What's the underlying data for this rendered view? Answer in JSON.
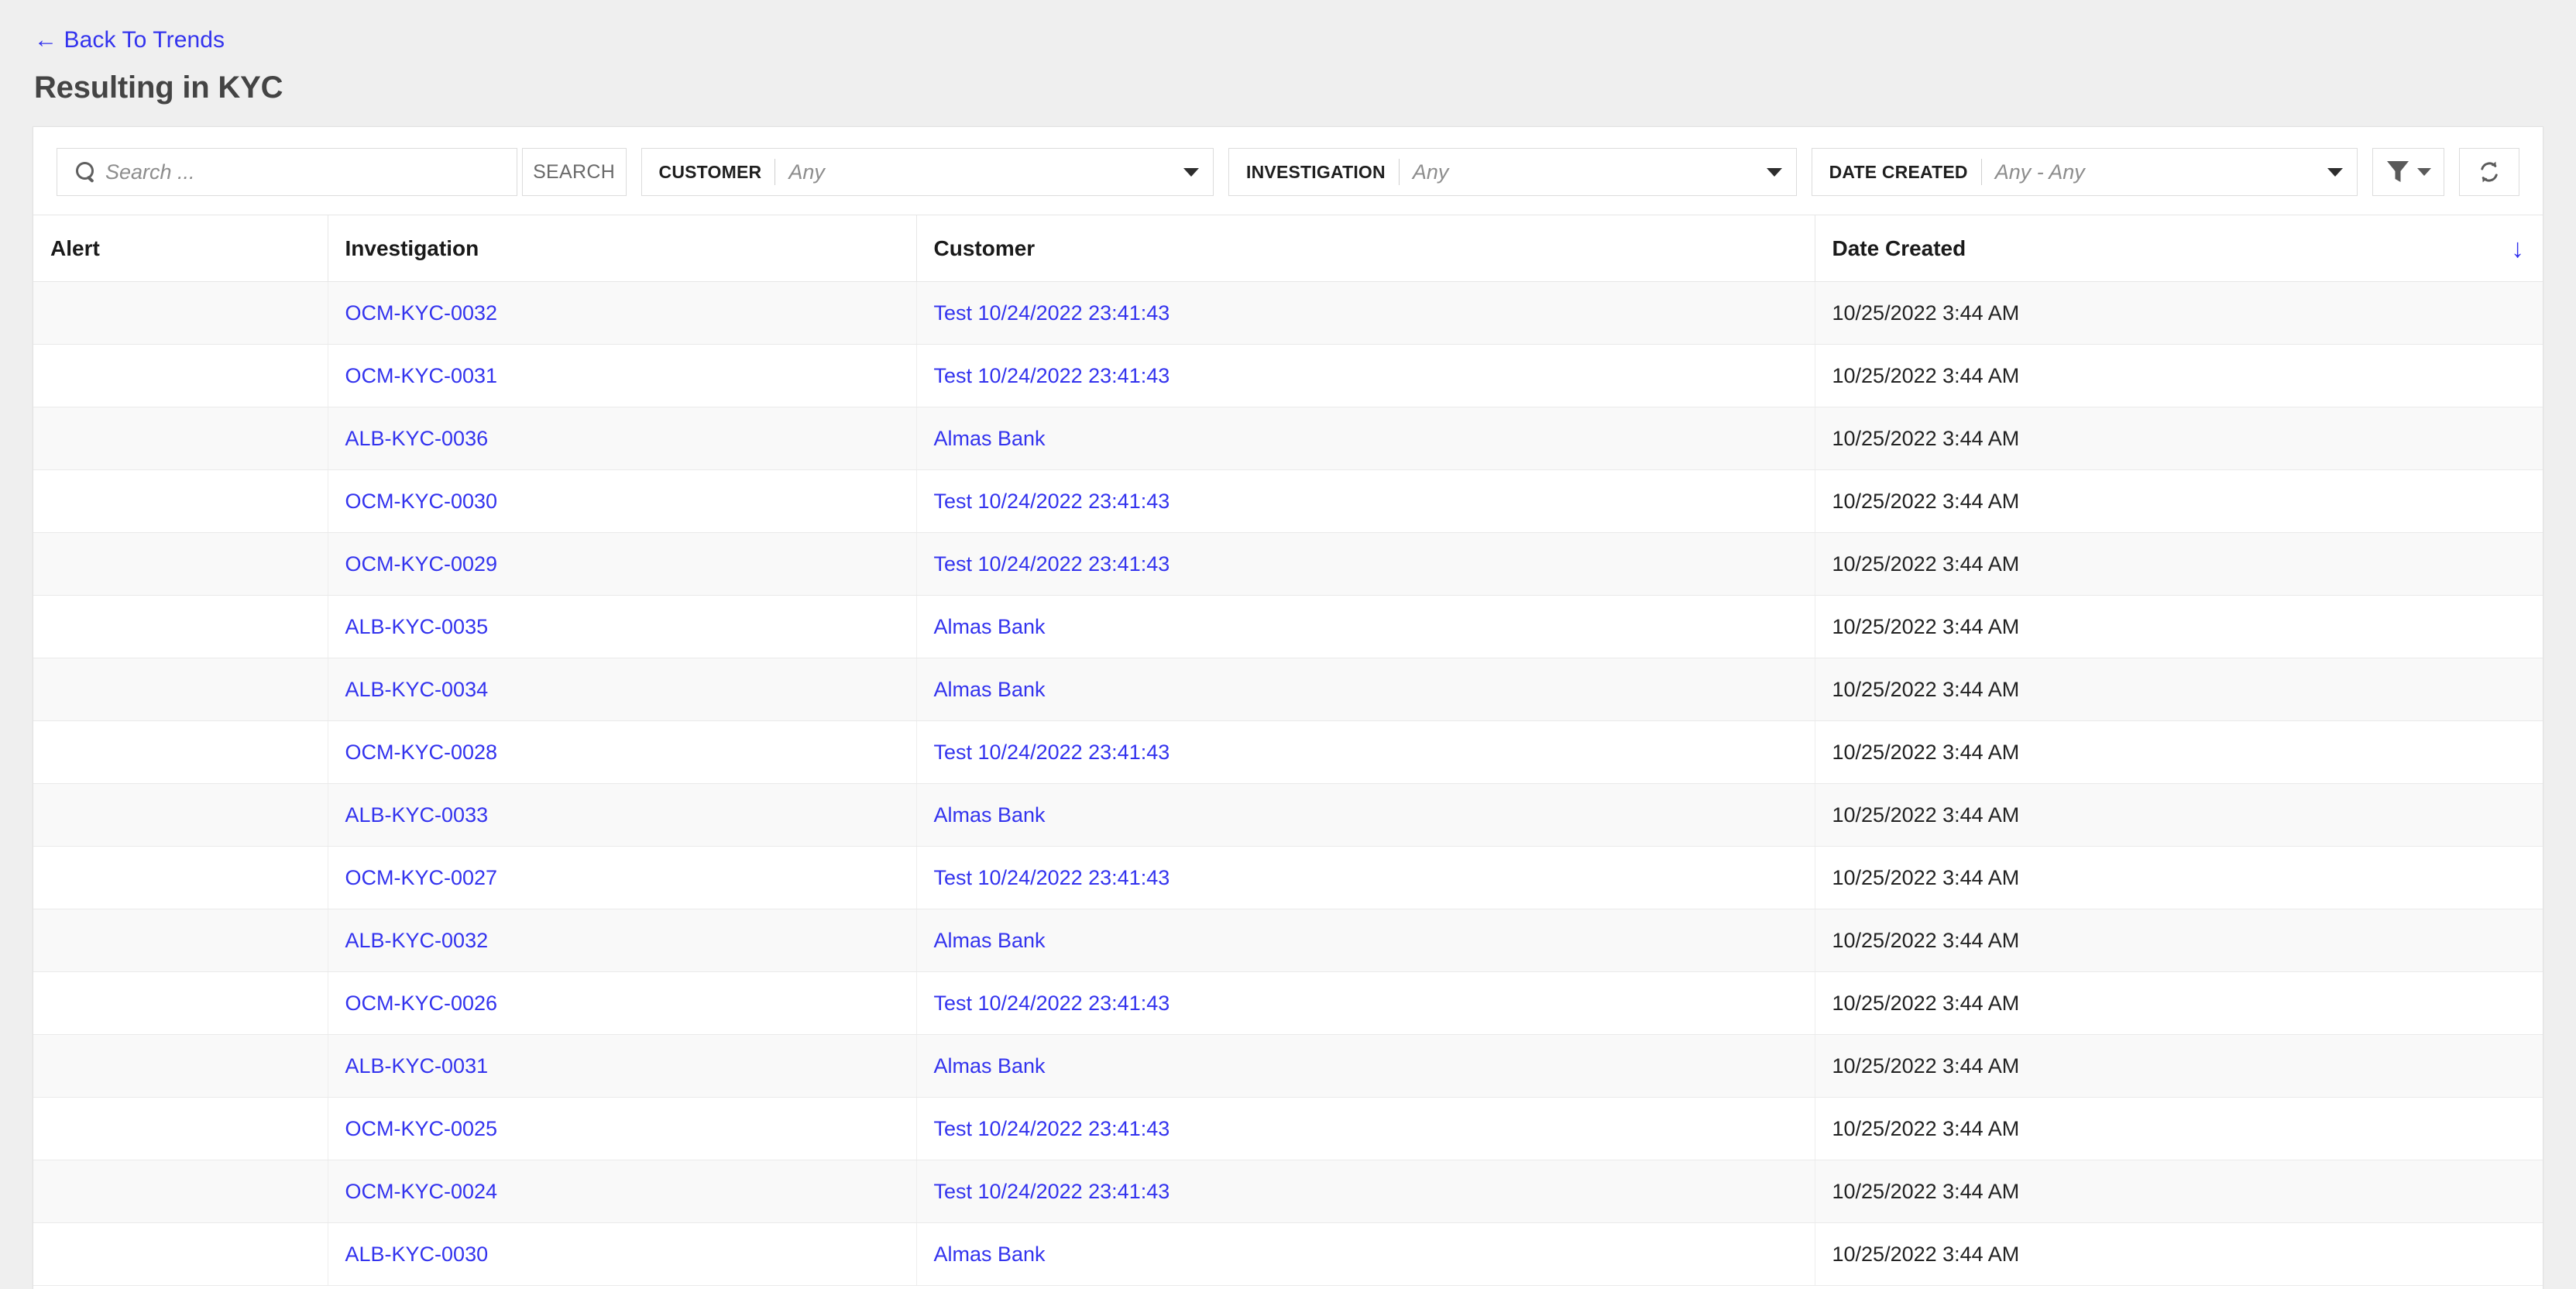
{
  "header": {
    "back_link": "← Back To Trends",
    "title": "Resulting in KYC"
  },
  "toolbar": {
    "search_placeholder": "Search ...",
    "search_value": "",
    "search_button": "SEARCH",
    "filters": [
      {
        "label": "CUSTOMER",
        "value": "Any"
      },
      {
        "label": "INVESTIGATION",
        "value": "Any"
      },
      {
        "label": "DATE CREATED",
        "value": "Any - Any"
      }
    ],
    "filter_button_icon": "funnel-icon",
    "refresh_button_icon": "refresh-icon"
  },
  "table": {
    "columns": [
      "Alert",
      "Investigation",
      "Customer",
      "Date Created"
    ],
    "sort": {
      "column": "Date Created",
      "direction": "descending",
      "glyph": "↓",
      "color": "#3333ee"
    },
    "rows": [
      {
        "alert": "",
        "investigation": "OCM-KYC-0032",
        "customer": "Test 10/24/2022 23:41:43",
        "date_created": "10/25/2022 3:44 AM"
      },
      {
        "alert": "",
        "investigation": "OCM-KYC-0031",
        "customer": "Test 10/24/2022 23:41:43",
        "date_created": "10/25/2022 3:44 AM"
      },
      {
        "alert": "",
        "investigation": "ALB-KYC-0036",
        "customer": "Almas Bank",
        "date_created": "10/25/2022 3:44 AM"
      },
      {
        "alert": "",
        "investigation": "OCM-KYC-0030",
        "customer": "Test 10/24/2022 23:41:43",
        "date_created": "10/25/2022 3:44 AM"
      },
      {
        "alert": "",
        "investigation": "OCM-KYC-0029",
        "customer": "Test 10/24/2022 23:41:43",
        "date_created": "10/25/2022 3:44 AM"
      },
      {
        "alert": "",
        "investigation": "ALB-KYC-0035",
        "customer": "Almas Bank",
        "date_created": "10/25/2022 3:44 AM"
      },
      {
        "alert": "",
        "investigation": "ALB-KYC-0034",
        "customer": "Almas Bank",
        "date_created": "10/25/2022 3:44 AM"
      },
      {
        "alert": "",
        "investigation": "OCM-KYC-0028",
        "customer": "Test 10/24/2022 23:41:43",
        "date_created": "10/25/2022 3:44 AM"
      },
      {
        "alert": "",
        "investigation": "ALB-KYC-0033",
        "customer": "Almas Bank",
        "date_created": "10/25/2022 3:44 AM"
      },
      {
        "alert": "",
        "investigation": "OCM-KYC-0027",
        "customer": "Test 10/24/2022 23:41:43",
        "date_created": "10/25/2022 3:44 AM"
      },
      {
        "alert": "",
        "investigation": "ALB-KYC-0032",
        "customer": "Almas Bank",
        "date_created": "10/25/2022 3:44 AM"
      },
      {
        "alert": "",
        "investigation": "OCM-KYC-0026",
        "customer": "Test 10/24/2022 23:41:43",
        "date_created": "10/25/2022 3:44 AM"
      },
      {
        "alert": "",
        "investigation": "ALB-KYC-0031",
        "customer": "Almas Bank",
        "date_created": "10/25/2022 3:44 AM"
      },
      {
        "alert": "",
        "investigation": "OCM-KYC-0025",
        "customer": "Test 10/24/2022 23:41:43",
        "date_created": "10/25/2022 3:44 AM"
      },
      {
        "alert": "",
        "investigation": "OCM-KYC-0024",
        "customer": "Test 10/24/2022 23:41:43",
        "date_created": "10/25/2022 3:44 AM"
      },
      {
        "alert": "",
        "investigation": "ALB-KYC-0030",
        "customer": "Almas Bank",
        "date_created": "10/25/2022 3:44 AM"
      }
    ]
  },
  "colors": {
    "link": "#3333ee",
    "page_background": "#efefef",
    "card_background": "#ffffff",
    "stripe": "#f9f9f9",
    "title_text": "#444444"
  }
}
